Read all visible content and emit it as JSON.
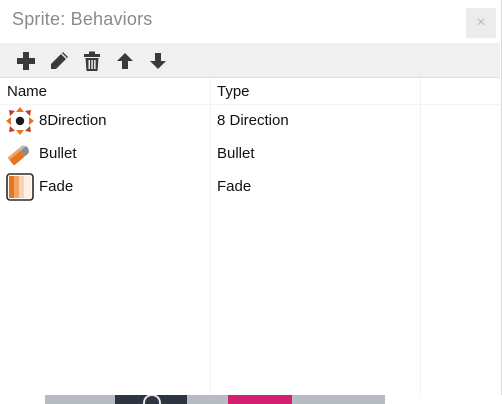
{
  "window": {
    "title": "Sprite: Behaviors",
    "close_label": "×"
  },
  "toolbar": {
    "buttons": [
      {
        "name": "add",
        "icon": "plus-icon"
      },
      {
        "name": "edit",
        "icon": "pencil-icon"
      },
      {
        "name": "delete",
        "icon": "trash-icon"
      },
      {
        "name": "move-up",
        "icon": "arrow-up-icon"
      },
      {
        "name": "move-down",
        "icon": "arrow-down-icon"
      }
    ]
  },
  "table": {
    "columns": [
      "Name",
      "Type"
    ],
    "rows": [
      {
        "name": "8Direction",
        "type": "8 Direction",
        "icon": "eight-direction-icon"
      },
      {
        "name": "Bullet",
        "type": "Bullet",
        "icon": "bullet-icon"
      },
      {
        "name": "Fade",
        "type": "Fade",
        "icon": "fade-icon"
      }
    ]
  },
  "colors": {
    "toolbar_bg": "#f0f0f0",
    "title_text": "#8a8a8a",
    "icon_dark": "#3a3a3a",
    "accent_orange": "#e8741c"
  }
}
